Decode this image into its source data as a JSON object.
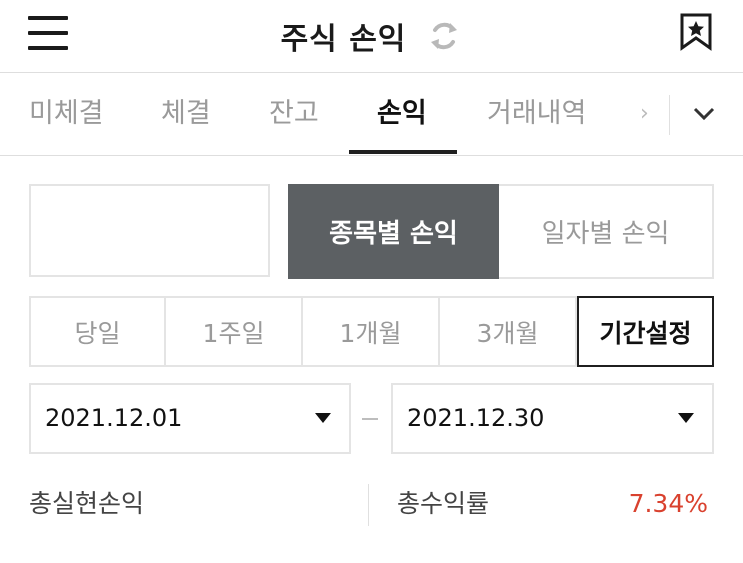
{
  "header": {
    "title": "주식 손익"
  },
  "tabs": [
    {
      "label": "미체결",
      "active": false
    },
    {
      "label": "체결",
      "active": false
    },
    {
      "label": "잔고",
      "active": false
    },
    {
      "label": "손익",
      "active": true
    },
    {
      "label": "거래내역",
      "active": false
    }
  ],
  "segment": {
    "by_stock": "종목별 손익",
    "by_date": "일자별 손익",
    "selected": "종목별 손익"
  },
  "periods": [
    {
      "label": "당일",
      "selected": false
    },
    {
      "label": "1주일",
      "selected": false
    },
    {
      "label": "1개월",
      "selected": false
    },
    {
      "label": "3개월",
      "selected": false
    },
    {
      "label": "기간설정",
      "selected": true
    }
  ],
  "date_range": {
    "start": "2021.12.01",
    "separator": "–",
    "end": "2021.12.30"
  },
  "summary": {
    "realized_label": "총실현손익",
    "return_label": "총수익률",
    "return_value": "7.34%"
  },
  "colors": {
    "accent_dark": "#5c6063",
    "positive_red": "#d9412e",
    "border": "#e4e4e4"
  }
}
